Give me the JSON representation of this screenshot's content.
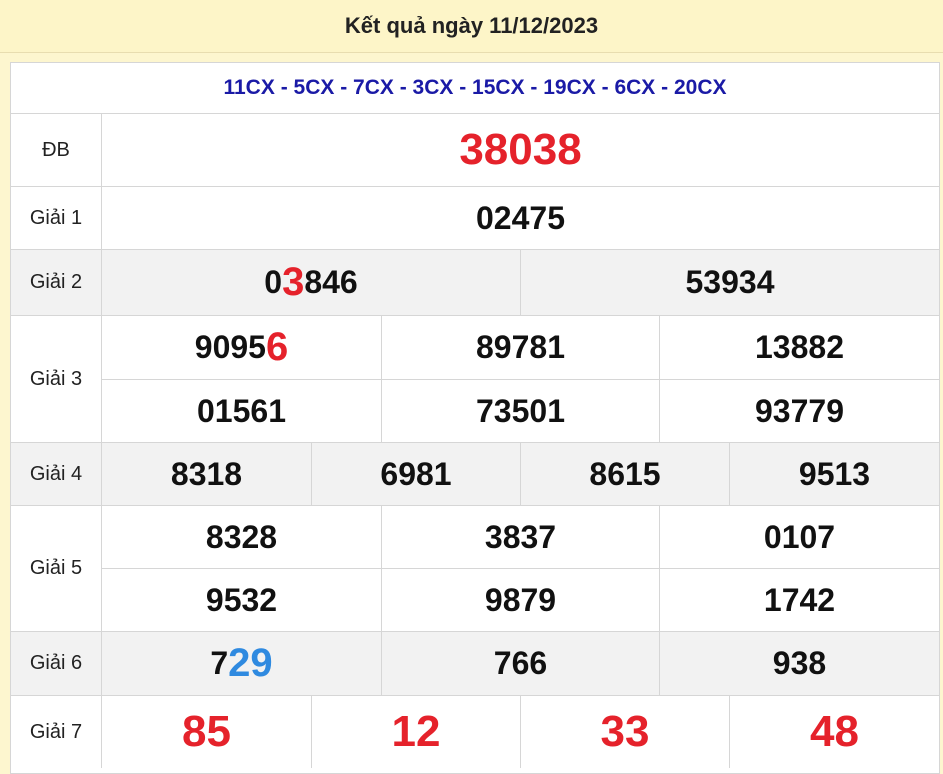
{
  "header": {
    "title": "Kết quả ngày 11/12/2023"
  },
  "codes": "11CX - 5CX - 7CX - 3CX - 15CX - 19CX - 6CX - 20CX",
  "prizes": {
    "db": {
      "label": "ĐB",
      "value": "38038"
    },
    "g1": {
      "label": "Giải 1",
      "value": "02475"
    },
    "g2": {
      "label": "Giải 2",
      "values": [
        {
          "pre": "0",
          "hl": "3",
          "post": "846"
        },
        {
          "pre": "53934",
          "hl": "",
          "post": ""
        }
      ]
    },
    "g3": {
      "label": "Giải 3",
      "values": [
        {
          "pre": "9095",
          "hl": "6",
          "post": ""
        },
        "89781",
        "13882",
        "01561",
        "73501",
        "93779"
      ]
    },
    "g4": {
      "label": "Giải 4",
      "values": [
        "8318",
        "6981",
        "8615",
        "9513"
      ]
    },
    "g5": {
      "label": "Giải 5",
      "values": [
        "8328",
        "3837",
        "0107",
        "9532",
        "9879",
        "1742"
      ]
    },
    "g6": {
      "label": "Giải 6",
      "values": [
        {
          "pre": "7",
          "hl": "29",
          "post": ""
        },
        "766",
        "938"
      ]
    },
    "g7": {
      "label": "Giải 7",
      "values": [
        "85",
        "12",
        "33",
        "48"
      ]
    }
  },
  "colors": {
    "highlight_red": "#e5222b",
    "highlight_blue": "#2f8ae0",
    "codes_blue": "#1a1aa6"
  }
}
